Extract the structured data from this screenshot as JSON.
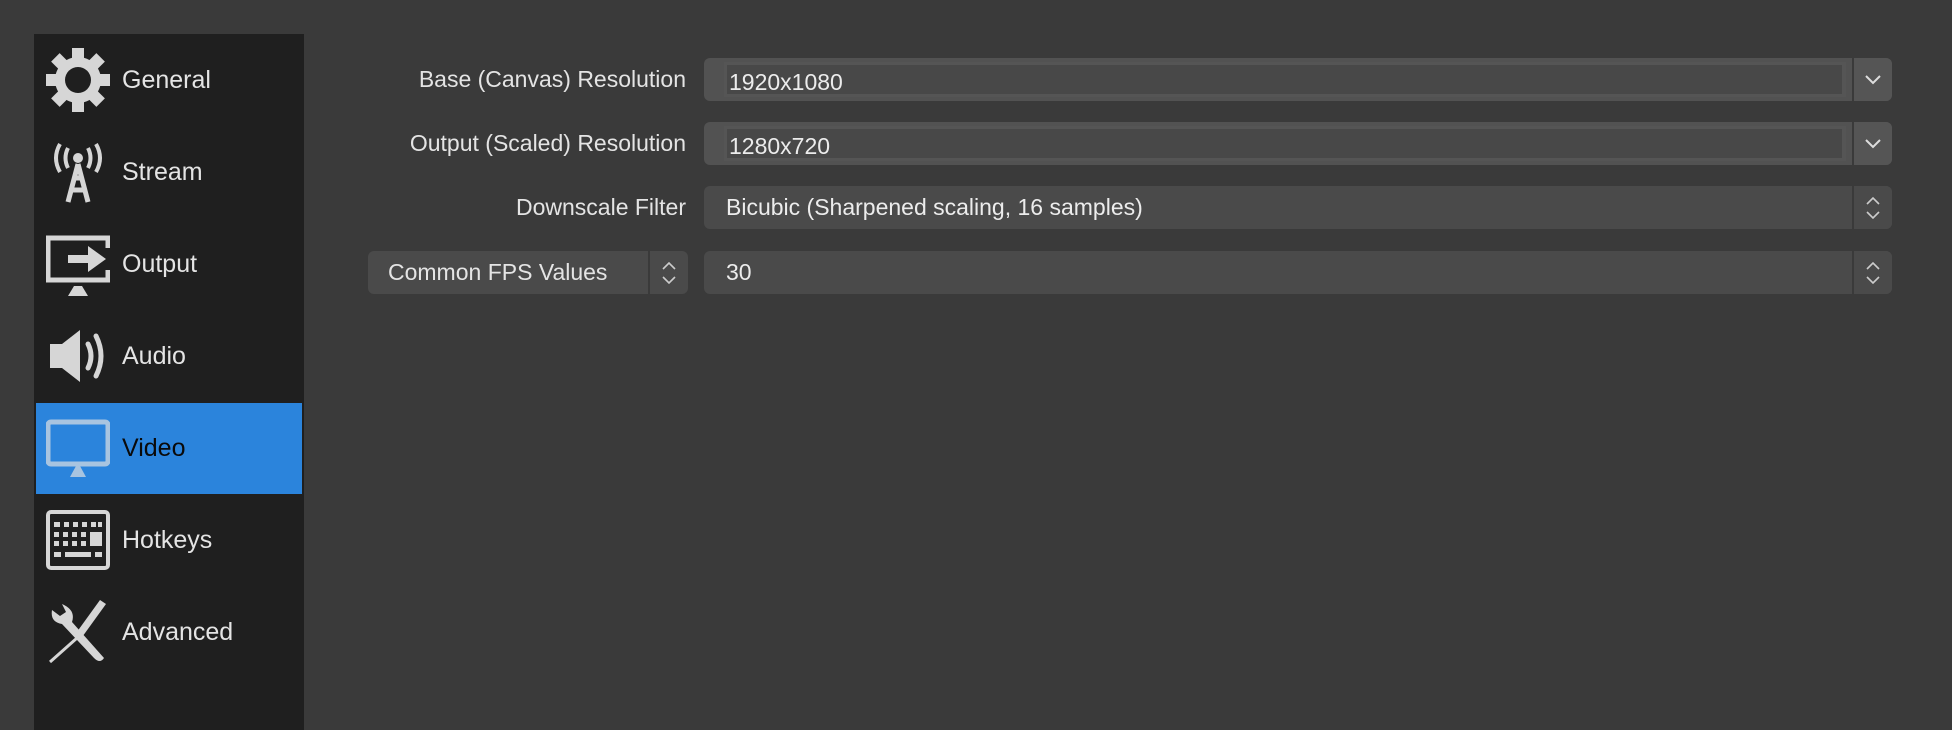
{
  "sidebar": {
    "items": [
      {
        "label": "General",
        "icon": "gear-icon"
      },
      {
        "label": "Stream",
        "icon": "antenna-icon"
      },
      {
        "label": "Output",
        "icon": "monitor-arrow-icon"
      },
      {
        "label": "Audio",
        "icon": "speaker-icon"
      },
      {
        "label": "Video",
        "icon": "monitor-icon",
        "active": true
      },
      {
        "label": "Hotkeys",
        "icon": "keyboard-icon"
      },
      {
        "label": "Advanced",
        "icon": "tools-icon"
      }
    ]
  },
  "video": {
    "base_resolution": {
      "label": "Base (Canvas) Resolution",
      "value": "1920x1080"
    },
    "output_resolution": {
      "label": "Output (Scaled) Resolution",
      "value": "1280x720"
    },
    "downscale_filter": {
      "label": "Downscale Filter",
      "value": "Bicubic (Sharpened scaling, 16 samples)"
    },
    "fps": {
      "type_label": "Common FPS Values",
      "value": "30"
    }
  },
  "colors": {
    "accent": "#2b84dc",
    "sidebar": "#1f1f1f",
    "background": "#3a3a3a"
  }
}
